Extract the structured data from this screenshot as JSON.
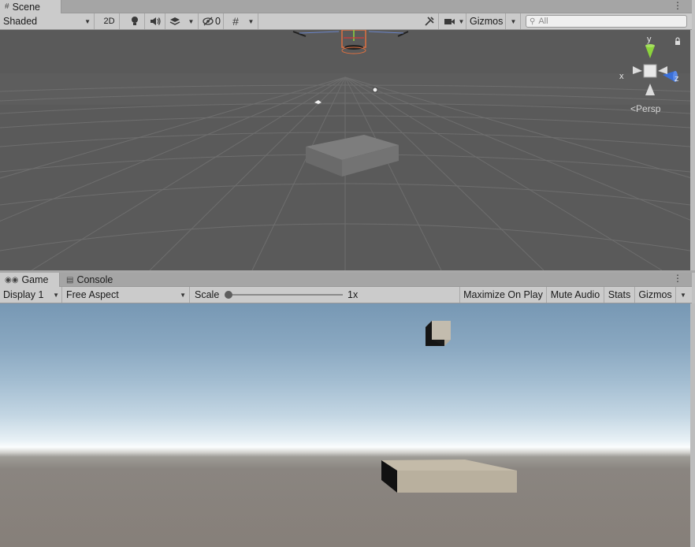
{
  "scene_tab": {
    "label": "Scene",
    "icon": "hash-icon"
  },
  "scene_toolbar": {
    "draw_mode": "Shaded",
    "mode_2d": "2D",
    "hidden_count": "0",
    "gizmos": "Gizmos",
    "search_placeholder": "All"
  },
  "scene_gizmo": {
    "x_label": "x",
    "y_label": "y",
    "z_label": "z",
    "projection": "Persp"
  },
  "game_tabs": [
    {
      "label": "Game",
      "icon": "gamepad-icon"
    },
    {
      "label": "Console",
      "icon": "console-icon"
    }
  ],
  "game_toolbar": {
    "display": "Display 1",
    "aspect": "Free Aspect",
    "scale_label": "Scale",
    "scale_value": "1x",
    "scale_slider_fraction": 0,
    "maximize_on_play": "Maximize On Play",
    "mute_audio": "Mute Audio",
    "stats": "Stats",
    "gizmos": "Gizmos"
  },
  "colors": {
    "scene_background": "#5a5a5a",
    "axis_x": "#d23b3b",
    "axis_y": "#8cd43c",
    "axis_z": "#3a6fd8",
    "toolbar": "#cbcbcb"
  }
}
